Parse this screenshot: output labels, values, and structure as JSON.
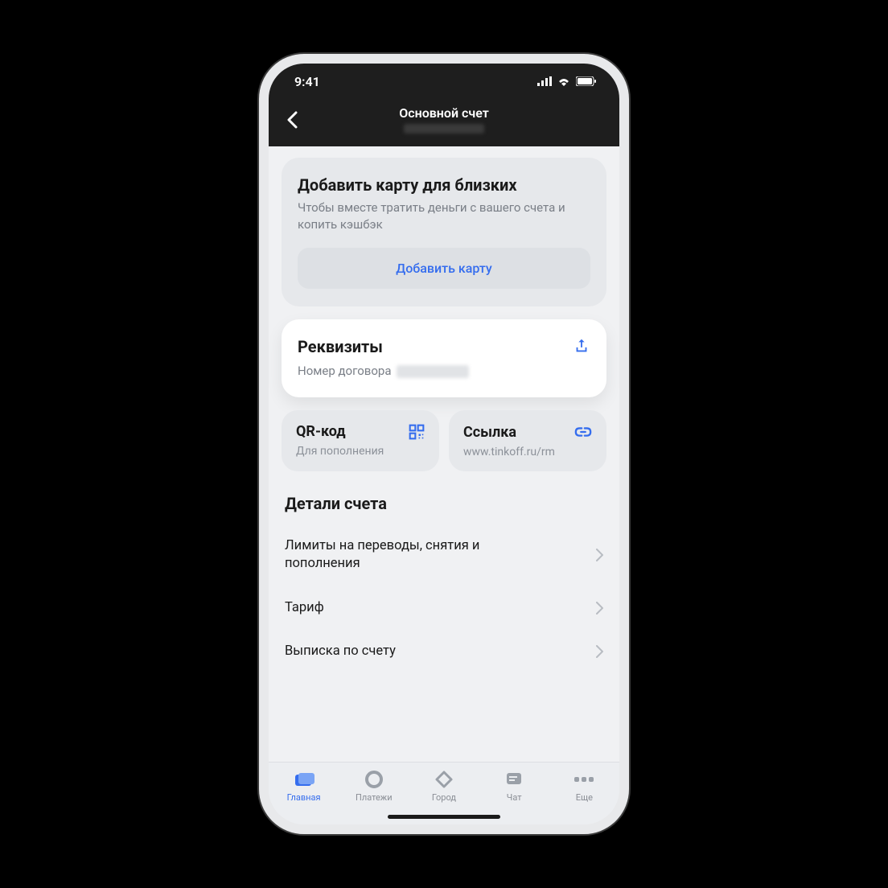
{
  "status": {
    "time": "9:41"
  },
  "header": {
    "title": "Основной счет"
  },
  "promo": {
    "title": "Добавить карту для близких",
    "subtitle": "Чтобы вместе тратить деньги с вашего счета и копить кэшбэк",
    "button": "Добавить карту"
  },
  "requisites": {
    "title": "Реквизиты",
    "contract_label": "Номер договора"
  },
  "qr": {
    "title": "QR-код",
    "subtitle": "Для пополнения"
  },
  "link": {
    "title": "Ссылка",
    "subtitle": "www.tinkoff.ru/rm"
  },
  "details": {
    "heading": "Детали счета",
    "items": {
      "limits": "Лимиты на переводы, снятия и пополнения",
      "tariff": "Тариф",
      "statement": "Выписка по счету"
    }
  },
  "tabs": {
    "home": "Главная",
    "payments": "Платежи",
    "city": "Город",
    "chat": "Чат",
    "more": "Еще"
  }
}
